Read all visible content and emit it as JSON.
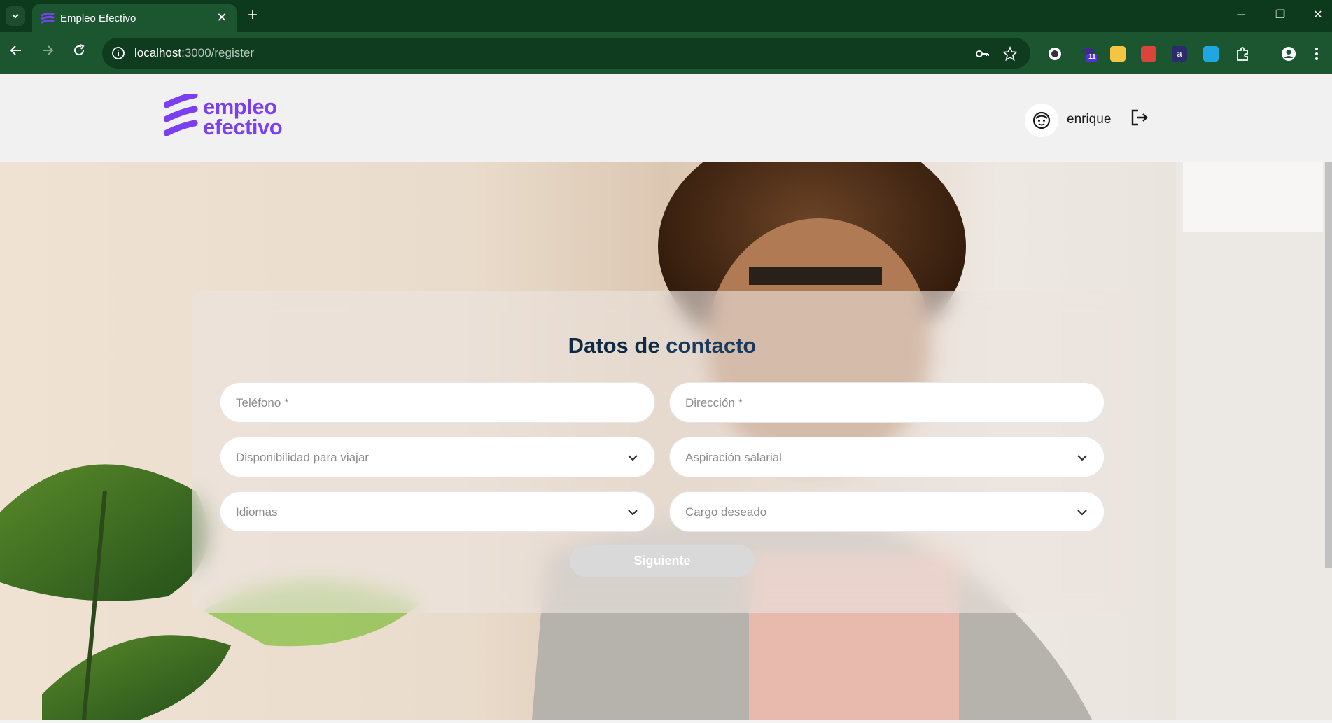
{
  "browser": {
    "tab_title": "Empleo Efectivo",
    "tab_close": "✕",
    "new_tab": "+",
    "url_host": "localhost",
    "url_path": ":3000/register",
    "window_minimize": "─",
    "window_restore": "❐",
    "window_close": "✕",
    "extension_badge": "11"
  },
  "header": {
    "logo_line1": "empleo",
    "logo_line2": "efectivo",
    "user_name": "enrique"
  },
  "form": {
    "title_part1": "Datos de ",
    "title_part2": "contacto",
    "fields": [
      {
        "placeholder": "Teléfono *",
        "type": "text"
      },
      {
        "placeholder": "Dirección *",
        "type": "text"
      },
      {
        "placeholder": "Disponibilidad para viajar",
        "type": "select"
      },
      {
        "placeholder": "Aspiración salarial",
        "type": "select"
      },
      {
        "placeholder": "Idiomas",
        "type": "select"
      },
      {
        "placeholder": "Cargo deseado",
        "type": "select"
      }
    ],
    "submit_label": "Siguiente"
  },
  "colors": {
    "brand": "#7a3ff0",
    "chrome_dark": "#0d3a1d",
    "chrome": "#1b5631",
    "title": "#0f2a44"
  }
}
